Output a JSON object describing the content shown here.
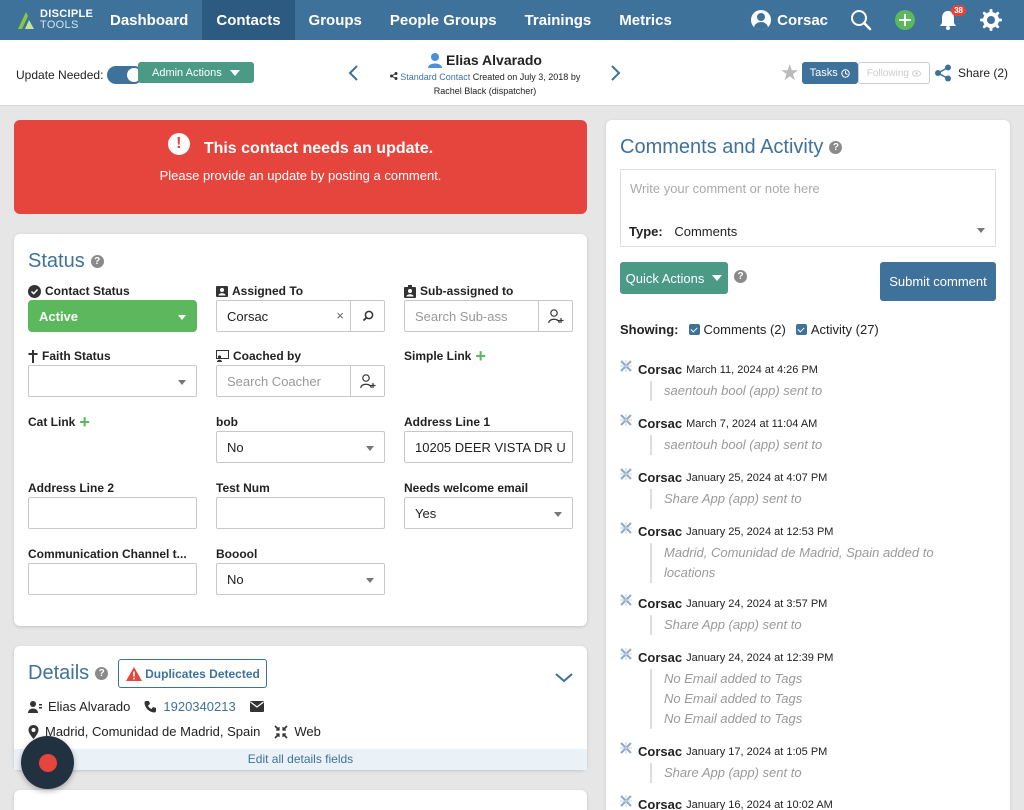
{
  "nav": {
    "logo_top": "DISCIPLE",
    "logo_bottom": "TOOLS",
    "links": [
      "Dashboard",
      "Contacts",
      "Groups",
      "People Groups",
      "Trainings",
      "Metrics"
    ],
    "user": "Corsac",
    "notif_count": "38",
    "accent": "#3f729b"
  },
  "subbar": {
    "update_needed": "Update Needed:",
    "admin_actions": "Admin Actions",
    "contact_name": "Elias Alvarado",
    "contact_type": "Standard Contact",
    "created": "Created on July 3, 2018 by",
    "created_by": "Rachel Black (dispatcher)",
    "tasks": "Tasks",
    "following": "Following",
    "share": "Share (2)"
  },
  "alert": {
    "title": "This contact needs an update.",
    "text": "Please provide an update by posting a comment.",
    "color": "#e5453d"
  },
  "status": {
    "title": "Status",
    "contact_status_label": "Contact Status",
    "contact_status_value": "Active",
    "assigned_label": "Assigned To",
    "assigned_value": "Corsac",
    "subassigned_label": "Sub-assigned to",
    "subassigned_placeholder": "Search Sub-ass",
    "faith_label": "Faith Status",
    "coached_label": "Coached by",
    "coached_placeholder": "Search Coacher",
    "simple_link_label": "Simple Link",
    "cat_link_label": "Cat Link",
    "bob_label": "bob",
    "bob_value": "No",
    "address1_label": "Address Line 1",
    "address1_value": "10205 DEER VISTA DR U",
    "address2_label": "Address Line 2",
    "testnum_label": "Test Num",
    "welcome_label": "Needs welcome email",
    "welcome_value": "Yes",
    "channel_label": "Communication Channel t...",
    "booool_label": "Booool",
    "booool_value": "No"
  },
  "details": {
    "title": "Details",
    "duplicates": "Duplicates Detected",
    "name": "Elias Alvarado",
    "phone": "1920340213",
    "location": "Madrid, Comunidad de Madrid, Spain",
    "source": "Web",
    "edit_all": "Edit all details fields"
  },
  "comments": {
    "title": "Comments and Activity",
    "placeholder": "Write your comment or note here",
    "type_label": "Type:",
    "type_value": "Comments",
    "quick_actions": "Quick Actions",
    "submit": "Submit comment",
    "showing": "Showing:",
    "filter_comments": "Comments (2)",
    "filter_activity": "Activity (27)",
    "activity": [
      {
        "user": "Corsac",
        "date": "March 11, 2024 at 4:26 PM",
        "lines": [
          "saentouh bool (app) sent to"
        ]
      },
      {
        "user": "Corsac",
        "date": "March 7, 2024 at 11:04 AM",
        "lines": [
          "saentouh bool (app) sent to"
        ]
      },
      {
        "user": "Corsac",
        "date": "January 25, 2024 at 4:07 PM",
        "lines": [
          "Share App (app) sent to"
        ]
      },
      {
        "user": "Corsac",
        "date": "January 25, 2024 at 12:53 PM",
        "lines": [
          "Madrid, Comunidad de Madrid, Spain added to",
          "locations"
        ]
      },
      {
        "user": "Corsac",
        "date": "January 24, 2024 at 3:57 PM",
        "lines": [
          "Share App (app) sent to"
        ]
      },
      {
        "user": "Corsac",
        "date": "January 24, 2024 at 12:39 PM",
        "lines": [
          "No Email added to Tags",
          "No Email added to Tags",
          "No Email added to Tags"
        ]
      },
      {
        "user": "Corsac",
        "date": "January 17, 2024 at 1:05 PM",
        "lines": [
          "Share App (app) sent to"
        ]
      },
      {
        "user": "Corsac",
        "date": "January 16, 2024 at 10:02 AM",
        "lines": []
      }
    ]
  }
}
